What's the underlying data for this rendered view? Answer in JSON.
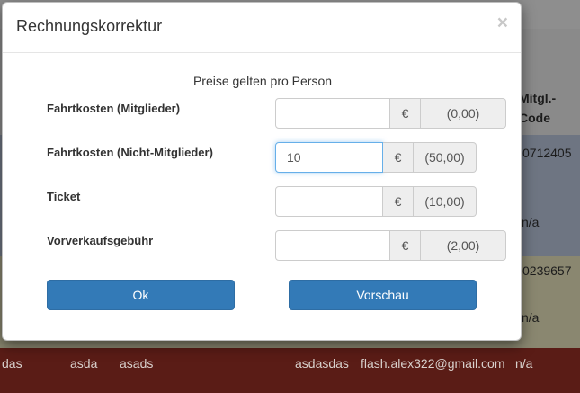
{
  "background": {
    "header_fragment_1": "Mitgl.-",
    "header_fragment_2": "Code",
    "code_1": "0712405",
    "na_1": "n/a",
    "code_2": "0239657",
    "na_2": "n/a",
    "footer_row": [
      "das",
      "asda",
      "asads",
      "asdasdas",
      "flash.alex322@gmail.com",
      "n/a"
    ]
  },
  "modal": {
    "title": "Rechnungskorrektur",
    "close_symbol": "×",
    "note": "Preise gelten pro Person",
    "currency_symbol": "€",
    "fields": [
      {
        "label": "Fahrtkosten (Mitglieder)",
        "value": "",
        "price": "(0,00)"
      },
      {
        "label": "Fahrtkosten (Nicht-Mitglieder)",
        "value": "10",
        "price": "(50,00)"
      },
      {
        "label": "Ticket",
        "value": "",
        "price": "(10,00)"
      },
      {
        "label": "Vorverkaufsgebühr",
        "value": "",
        "price": "(2,00)"
      }
    ],
    "buttons": {
      "ok": "Ok",
      "preview": "Vorschau"
    }
  }
}
